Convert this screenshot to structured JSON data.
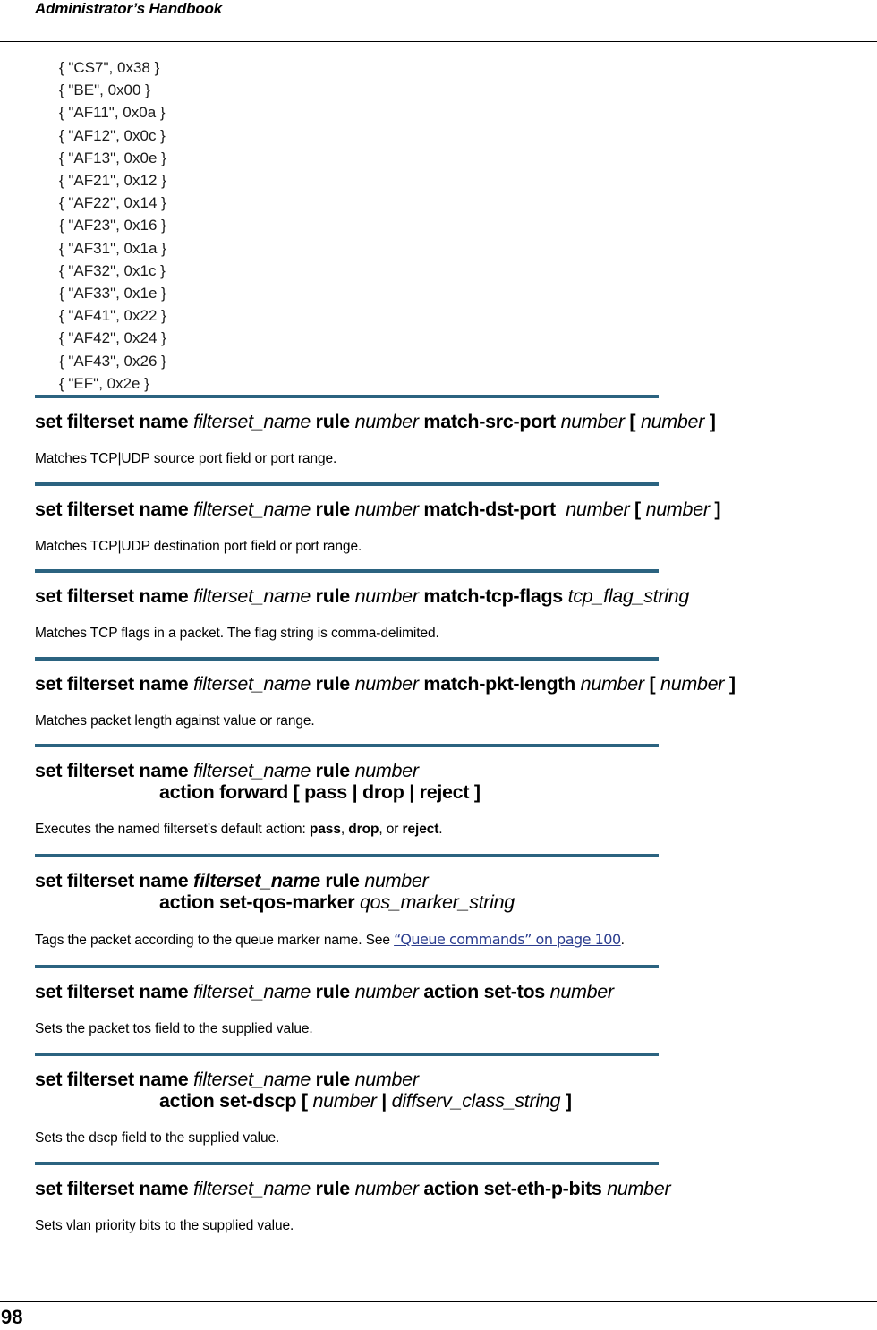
{
  "header": {
    "title": "Administrator’s Handbook"
  },
  "accent_color": "#2b6380",
  "link_color": "#2b3d8f",
  "code_lines": [
    "{ \"CS7\", 0x38 }",
    "{ \"BE\", 0x00 }",
    "{ \"AF11\", 0x0a }",
    "{ \"AF12\", 0x0c }",
    "{ \"AF13\", 0x0e }",
    "{ \"AF21\", 0x12 }",
    "{ \"AF22\", 0x14 }",
    "{ \"AF23\", 0x16 }",
    "{ \"AF31\", 0x1a }",
    "{ \"AF32\", 0x1c }",
    "{ \"AF33\", 0x1e }",
    "{ \"AF41\", 0x22 }",
    "{ \"AF42\", 0x24 }",
    "{ \"AF43\", 0x26 }",
    "{ \"EF\", 0x2e }"
  ],
  "common": {
    "set_filterset_name": "set filterset name",
    "filterset_name": "filterset_name",
    "rule": "rule",
    "number": "number",
    "open_bracket": "[",
    "close_bracket": "]",
    "pipe": "|"
  },
  "sections": [
    {
      "keyword": "match-src-port",
      "description": "Matches TCP|UDP source port field or port range."
    },
    {
      "keyword": "match-dst-port",
      "description": "Matches TCP|UDP destination port field or port range."
    },
    {
      "keyword": "match-tcp-flags",
      "arg": "tcp_flag_string",
      "description": "Matches TCP flags in a packet. The flag string is comma-delimited."
    },
    {
      "keyword": "match-pkt-length",
      "description": "Matches packet length against value or range."
    },
    {
      "keyword": "action forward [ pass | drop | reject ]",
      "description_prefix": "Executes the named filterset’s default action: ",
      "opt_pass": "pass",
      "opt_drop": "drop",
      "opt_reject": "reject",
      "sep1": ", ",
      "sep2": ", or ",
      "end": "."
    },
    {
      "keyword": "action set-qos-marker",
      "arg": "qos_marker_string",
      "description_prefix": "Tags the packet according to the queue marker name. See ",
      "link_text": "“Queue commands” on page 100",
      "end": "."
    },
    {
      "keyword": "action set-tos",
      "description": "Sets the packet tos field to the supplied value."
    },
    {
      "keyword": "action set-dscp",
      "arg": "diffserv_class_string",
      "description": "Sets the dscp field to the supplied value."
    },
    {
      "keyword": "action set-eth-p-bits",
      "description": "Sets vlan priority bits to the supplied value."
    }
  ],
  "footer": {
    "page_number": "98"
  }
}
